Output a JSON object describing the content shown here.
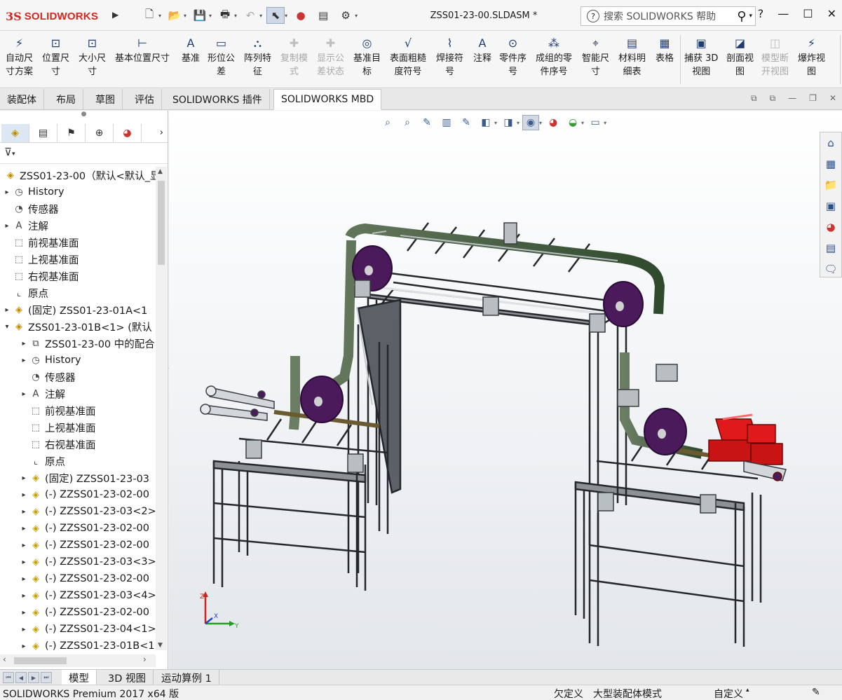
{
  "app": {
    "logo_mark": "3S",
    "logo_text": "SOLIDWORKS",
    "document_title": "ZSS01-23-00.SLDASM *",
    "search_placeholder": "搜索 SOLIDWORKS 帮助",
    "help_symbol": "?"
  },
  "ribbon": {
    "items": [
      {
        "label": "自动尺\n寸方案",
        "icon": "auto-dimension-icon",
        "enabled": true
      },
      {
        "label": "位置尺\n寸",
        "icon": "location-dimension-icon",
        "enabled": true
      },
      {
        "label": "大小尺\n寸",
        "icon": "size-dimension-icon",
        "enabled": true
      },
      {
        "label": "基本位置尺寸",
        "icon": "basic-location-dimension-icon",
        "enabled": true
      },
      {
        "label": "基准",
        "icon": "datum-icon",
        "enabled": true
      },
      {
        "label": "形位公\n差",
        "icon": "geometric-tolerance-icon",
        "enabled": true
      },
      {
        "label": "阵列特\n征",
        "icon": "pattern-feature-icon",
        "enabled": true
      },
      {
        "label": "复制模\n式",
        "icon": "copy-scheme-icon",
        "enabled": false
      },
      {
        "label": "显示公\n差状态",
        "icon": "show-tolerance-status-icon",
        "enabled": false
      },
      {
        "label": "基准目\n标",
        "icon": "datum-target-icon",
        "enabled": true
      },
      {
        "label": "表面粗糙\n度符号",
        "icon": "surface-finish-icon",
        "enabled": true
      },
      {
        "label": "焊接符\n号",
        "icon": "weld-symbol-icon",
        "enabled": true
      },
      {
        "label": "注释",
        "icon": "note-icon",
        "enabled": true
      },
      {
        "label": "零件序\n号",
        "icon": "balloon-icon",
        "enabled": true
      },
      {
        "label": "成组的零\n件序号",
        "icon": "stacked-balloon-icon",
        "enabled": true
      },
      {
        "label": "智能尺\n寸",
        "icon": "smart-dimension-icon",
        "enabled": true
      },
      {
        "label": "材料明\n细表",
        "icon": "bom-icon",
        "enabled": true
      },
      {
        "label": "表格",
        "icon": "table-icon",
        "enabled": true
      },
      {
        "label": "捕获 3D\n视图",
        "icon": "capture-3d-view-icon",
        "enabled": true
      },
      {
        "label": "剖面视\n图",
        "icon": "section-view-icon",
        "enabled": true
      },
      {
        "label": "模型断\n开视图",
        "icon": "model-break-view-icon",
        "enabled": false
      },
      {
        "label": "爆炸视\n图",
        "icon": "exploded-view-icon",
        "enabled": true
      }
    ]
  },
  "command_tabs": [
    "装配体",
    "布局",
    "草图",
    "评估",
    "SOLIDWORKS 插件",
    "SOLIDWORKS MBD"
  ],
  "command_tabs_active": 5,
  "tree": {
    "items": [
      {
        "label": "ZSS01-23-00（默认<默认_显",
        "icon": "assembly-icon",
        "indent": 0,
        "expander": ""
      },
      {
        "label": "History",
        "icon": "history-icon",
        "indent": 1,
        "expander": "▸"
      },
      {
        "label": "传感器",
        "icon": "sensor-icon",
        "indent": 1,
        "expander": ""
      },
      {
        "label": "注解",
        "icon": "annotation-icon",
        "indent": 1,
        "expander": "▸"
      },
      {
        "label": "前视基准面",
        "icon": "plane-icon",
        "indent": 1,
        "expander": ""
      },
      {
        "label": "上视基准面",
        "icon": "plane-icon",
        "indent": 1,
        "expander": ""
      },
      {
        "label": "右视基准面",
        "icon": "plane-icon",
        "indent": 1,
        "expander": ""
      },
      {
        "label": "原点",
        "icon": "origin-icon",
        "indent": 1,
        "expander": ""
      },
      {
        "label": "(固定) ZSS01-23-01A<1",
        "icon": "subassembly-icon",
        "indent": 1,
        "expander": "▸"
      },
      {
        "label": "ZSS01-23-01B<1> (默认",
        "icon": "subassembly-icon",
        "indent": 1,
        "expander": "▾"
      },
      {
        "label": "ZSS01-23-00 中的配合",
        "icon": "mates-icon",
        "indent": 2,
        "expander": "▸"
      },
      {
        "label": "History",
        "icon": "history-icon",
        "indent": 2,
        "expander": "▸"
      },
      {
        "label": "传感器",
        "icon": "sensor-icon",
        "indent": 2,
        "expander": ""
      },
      {
        "label": "注解",
        "icon": "annotation-icon",
        "indent": 2,
        "expander": "▸"
      },
      {
        "label": "前视基准面",
        "icon": "plane-icon",
        "indent": 2,
        "expander": ""
      },
      {
        "label": "上视基准面",
        "icon": "plane-icon",
        "indent": 2,
        "expander": ""
      },
      {
        "label": "右视基准面",
        "icon": "plane-icon",
        "indent": 2,
        "expander": ""
      },
      {
        "label": "原点",
        "icon": "origin-icon",
        "indent": 2,
        "expander": ""
      },
      {
        "label": "(固定) ZZSS01-23-03",
        "icon": "part-icon",
        "indent": 2,
        "expander": "▸"
      },
      {
        "label": "(-) ZZSS01-23-02-00",
        "icon": "part-icon",
        "indent": 2,
        "expander": "▸"
      },
      {
        "label": "(-) ZZSS01-23-03<2>",
        "icon": "part-icon",
        "indent": 2,
        "expander": "▸"
      },
      {
        "label": "(-) ZZSS01-23-02-00",
        "icon": "part-icon",
        "indent": 2,
        "expander": "▸"
      },
      {
        "label": "(-) ZZSS01-23-02-00",
        "icon": "part-icon",
        "indent": 2,
        "expander": "▸"
      },
      {
        "label": "(-) ZZSS01-23-03<3>",
        "icon": "part-icon",
        "indent": 2,
        "expander": "▸"
      },
      {
        "label": "(-) ZZSS01-23-02-00",
        "icon": "part-icon",
        "indent": 2,
        "expander": "▸"
      },
      {
        "label": "(-) ZZSS01-23-03<4>",
        "icon": "part-icon",
        "indent": 2,
        "expander": "▸"
      },
      {
        "label": "(-) ZZSS01-23-02-00",
        "icon": "part-icon",
        "indent": 2,
        "expander": "▸"
      },
      {
        "label": "(-) ZZSS01-23-04<1>",
        "icon": "part-icon",
        "indent": 2,
        "expander": "▸"
      },
      {
        "label": "(-) ZZSS01-23-01B<1>",
        "icon": "part-icon",
        "indent": 2,
        "expander": "▸"
      }
    ]
  },
  "bottom_tabs": [
    "模型",
    "3D 视图",
    "运动算例 1"
  ],
  "bottom_tabs_active": 0,
  "status": {
    "product": "SOLIDWORKS Premium 2017 x64 版",
    "definition": "欠定义",
    "mode": "大型装配体模式",
    "units": "自定义"
  },
  "triad": {
    "x_label": "X",
    "y_label": "Y",
    "z_label": "Z"
  },
  "colors": {
    "brand_red": "#d9251d",
    "frame": "#3a3d42",
    "roller": "#4a1a5a",
    "motor": "#e01a1a",
    "belt": "#2c5a2a"
  }
}
